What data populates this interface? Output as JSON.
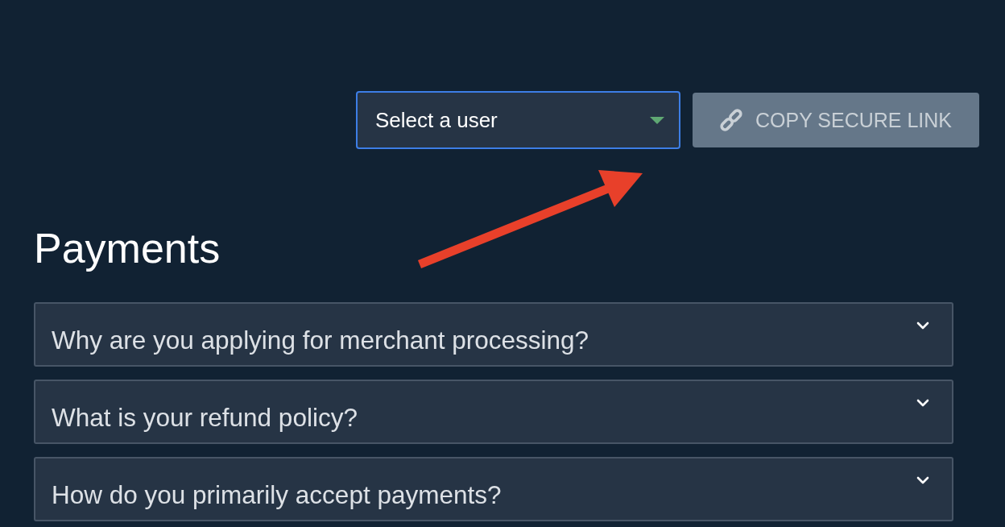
{
  "toolbar": {
    "user_select": {
      "placeholder": "Select a user",
      "focused": true
    },
    "copy_link_button": {
      "label": "COPY SECURE LINK",
      "disabled": true
    }
  },
  "section": {
    "title": "Payments",
    "accordion": [
      {
        "question": "Why are you applying for merchant processing?",
        "expanded": false
      },
      {
        "question": "What is your refund policy?",
        "expanded": false
      },
      {
        "question": "How do you primarily accept payments?",
        "expanded": false
      }
    ]
  }
}
